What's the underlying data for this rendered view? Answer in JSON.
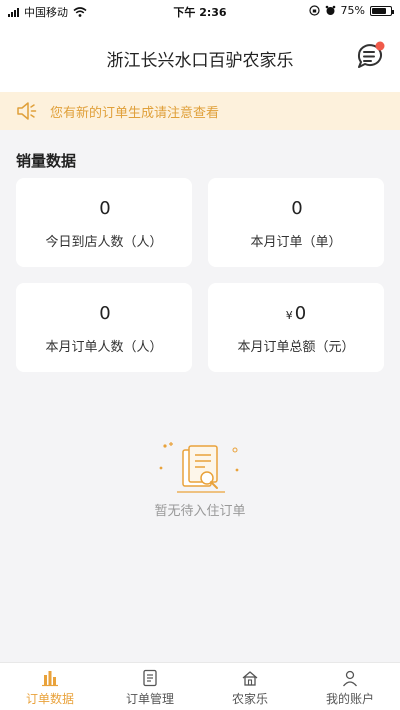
{
  "status_bar": {
    "carrier": "中国移动",
    "time": "下午 2:36",
    "battery": "75%",
    "battery_level": 0.75
  },
  "header": {
    "title": "浙江长兴水口百驴农家乐",
    "message_icon": "chat-bubble-icon"
  },
  "notice": {
    "icon": "speaker-icon",
    "text": "您有新的订单生成请注意查看"
  },
  "sales": {
    "title": "销量数据",
    "cards": [
      {
        "value": "0",
        "currency": "",
        "label": "今日到店人数（人）"
      },
      {
        "value": "0",
        "currency": "",
        "label": "本月订单（单）"
      },
      {
        "value": "0",
        "currency": "",
        "label": "本月订单人数（人）"
      },
      {
        "value": "0",
        "currency": "¥",
        "label": "本月订单总额（元）"
      }
    ]
  },
  "empty_state": {
    "icon": "empty-document-icon",
    "text": "暂无待入住订单"
  },
  "tabbar": {
    "tabs": [
      {
        "label": "订单数据",
        "icon": "bar-chart-icon",
        "active": true
      },
      {
        "label": "订单管理",
        "icon": "list-icon",
        "active": false
      },
      {
        "label": "农家乐",
        "icon": "home-icon",
        "active": false
      },
      {
        "label": "我的账户",
        "icon": "user-icon",
        "active": false
      }
    ]
  },
  "colors": {
    "accent": "#e9a23b",
    "notice_bg": "#fdf1dc",
    "badge": "#f05a4a"
  }
}
